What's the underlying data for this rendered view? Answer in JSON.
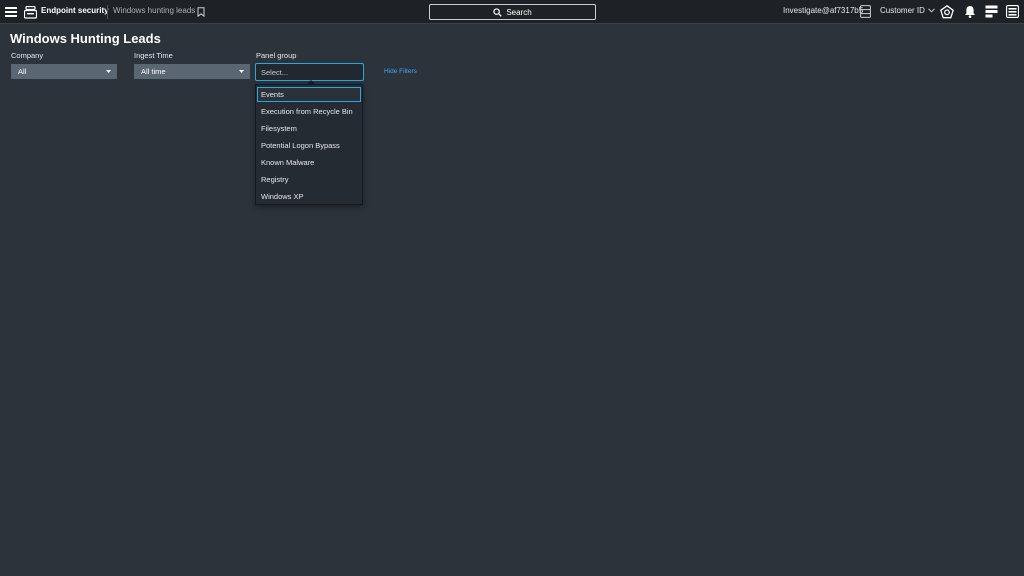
{
  "topbar": {
    "product_name": "Endpoint security",
    "breadcrumb": "Windows hunting leads",
    "search_label": "Search",
    "user": "Investigate@af7317b5",
    "customer_label": "Customer ID",
    "icons": [
      "menu-icon",
      "product-icon",
      "bookmark-icon",
      "search-icon",
      "database-icon",
      "chevron-down-icon",
      "help-icon",
      "bell-icon",
      "apps-icon",
      "collapse-icon"
    ]
  },
  "page": {
    "title": "Windows Hunting Leads"
  },
  "filters": {
    "company": {
      "label": "Company",
      "value": "All"
    },
    "ingest_time": {
      "label": "Ingest Time",
      "value": "All time"
    },
    "panel_group": {
      "label": "Panel group",
      "placeholder": "Select...",
      "options": [
        "Events",
        "Execution from Recycle Bin",
        "Filesystem",
        "Potential Logon Bypass",
        "Known Malware",
        "Registry",
        "Windows XP"
      ]
    },
    "hide_filters": "Hide Filters"
  },
  "colors": {
    "background": "#2d333b",
    "topbar": "#1e2227",
    "select": "#5b6673",
    "accent": "#2aa7e0",
    "link": "#3fa9f5"
  }
}
